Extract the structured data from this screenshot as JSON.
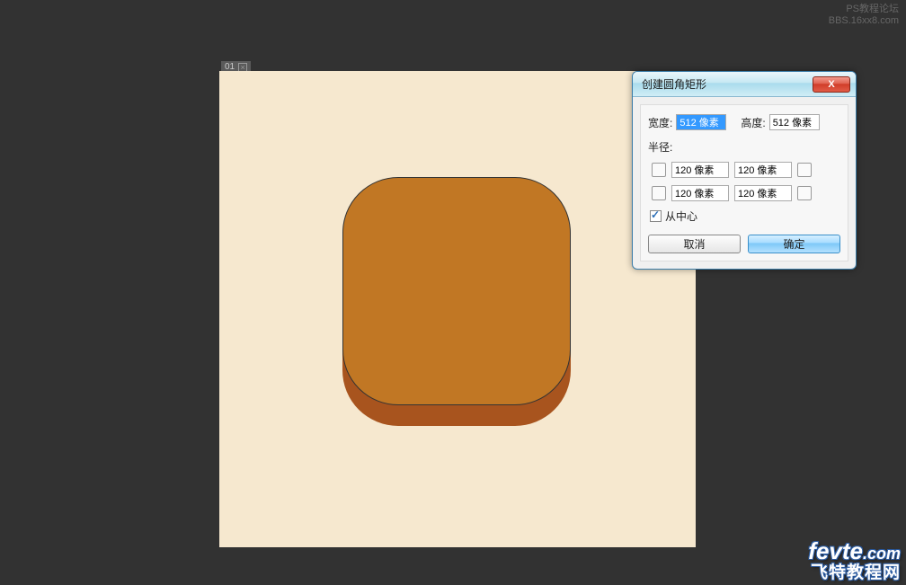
{
  "watermark_top": {
    "line1": "PS教程论坛",
    "line2": "BBS.16xx8.com"
  },
  "canvas": {
    "tab_label": "01",
    "background": "#f6e8cf",
    "shape_top_color": "#c17724",
    "shape_base_color": "#a8541e"
  },
  "dialog": {
    "title": "创建圆角矩形",
    "close_label": "X",
    "width_label": "宽度:",
    "width_value": "512 像素",
    "height_label": "高度:",
    "height_value": "512 像素",
    "radius_label": "半径:",
    "radius_tl": "120 像素",
    "radius_tr": "120 像素",
    "radius_bl": "120 像素",
    "radius_br": "120 像素",
    "from_center_label": "从中心",
    "from_center_checked": true,
    "cancel_label": "取消",
    "ok_label": "确定"
  },
  "watermark_bottom": {
    "brand": "fevte",
    "tld": ".com",
    "cn": "飞特教程网"
  }
}
